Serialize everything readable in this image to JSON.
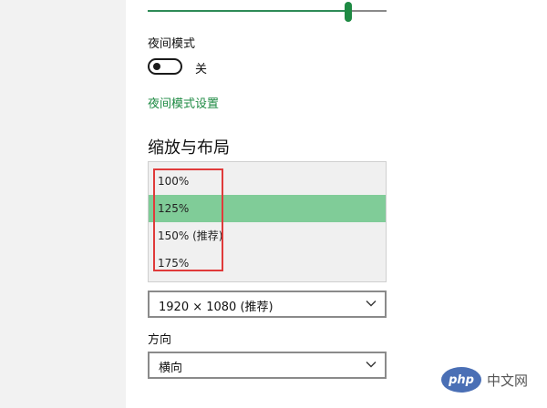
{
  "night_mode": {
    "label": "夜间模式",
    "state_label": "关",
    "settings_link": "夜间模式设置"
  },
  "scale_layout": {
    "title": "缩放与布局",
    "options": [
      "100%",
      "125%",
      "150% (推荐)",
      "175%"
    ],
    "selected": "125%"
  },
  "resolution": {
    "value": "1920 × 1080 (推荐)"
  },
  "orientation": {
    "label": "方向",
    "value": "横向"
  },
  "watermark": {
    "logo_text": "php",
    "site_text": "中文网"
  },
  "colors": {
    "accent": "#1e8a43",
    "selected_row": "#80cc98",
    "highlight_box": "#e03a3a"
  }
}
